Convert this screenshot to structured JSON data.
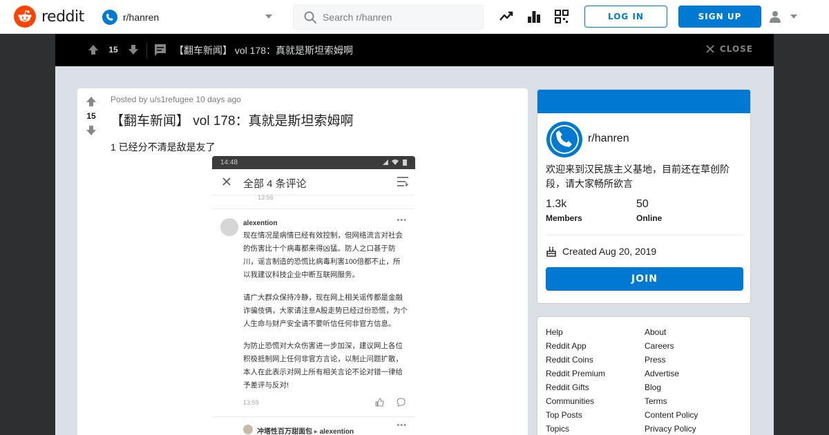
{
  "header": {
    "brand": "reddit",
    "subreddit": "r/hanren",
    "search_placeholder": "Search r/hanren",
    "login_label": "LOG IN",
    "signup_label": "SIGN UP"
  },
  "post_bar": {
    "score": "15",
    "title": "【翻车新闻】 vol 178：真就是斯坦索姆啊",
    "close_label": "CLOSE"
  },
  "post": {
    "posted_by_prefix": "Posted by",
    "author": "u/s1refugee",
    "time_ago": "10 days ago",
    "score": "15",
    "title": "【翻车新闻】 vol 178：真就是斯坦索姆啊",
    "body": "1 已经分不清是敌是友了",
    "screenshot": {
      "status_time": "14:48",
      "header_title": "全部 4 条评论",
      "prev_time": "13:56",
      "commenter": "alexention",
      "para1": "现在情况是病情已经有效控制，但网络流言对社会的伤害比十个病毒都来得凶猛。防人之口甚于防川，谣言制造的恐慌比病毒利害100倍都不止，所以我建议科技企业中断互联网服务。",
      "para2": "请广大群众保持冷静，现在网上相关谣传都是金融诈骗伎俩，大家请注意A股走势已经过份恐慌，为个人生命与财产安全请不要听信任何非官方信息。",
      "para3": "为防止恐慌对大众伤害进一步加深，建议网上各位积极抵制网上任何非官方言论，以制止问题扩散，本人在此表示对网上所有相关言论不论对错一律给予差评与反对!",
      "comment_time": "13:59",
      "reply_from": "冲塔性百万甜面包",
      "reply_to": "alexention"
    }
  },
  "community": {
    "name": "r/hanren",
    "description": "欢迎来到汉民族主义基地，目前还在草创阶段，请大家畅所欲言",
    "members_count": "1.3k",
    "members_label": "Members",
    "online_count": "50",
    "online_label": "Online",
    "created": "Created Aug 20, 2019",
    "join_label": "JOIN"
  },
  "footer_links": {
    "left": [
      "Help",
      "Reddit App",
      "Reddit Coins",
      "Reddit Premium",
      "Reddit Gifts",
      "Communities",
      "Top Posts",
      "Topics"
    ],
    "right": [
      "About",
      "Careers",
      "Press",
      "Advertise",
      "Blog",
      "Terms",
      "Content Policy",
      "Privacy Policy"
    ]
  },
  "colors": {
    "brand": "#ff4500",
    "accent": "#0079d3",
    "page_bg": "#dae0e6",
    "overlay_bg": "#2e2f30"
  }
}
